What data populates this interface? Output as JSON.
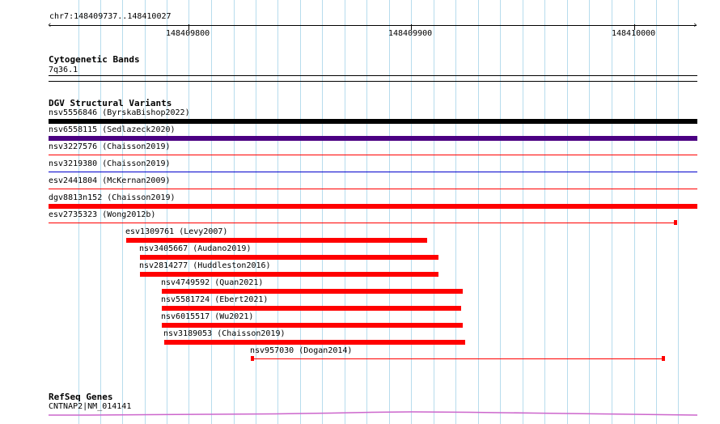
{
  "ruler": {
    "location": "chr7:148409737..148410027",
    "ticks": [
      "148409800",
      "148409900",
      "148410000"
    ]
  },
  "tracks": {
    "cytoband": {
      "title": "Cytogenetic Bands",
      "band_label": "7q36.1"
    },
    "dgv": {
      "title": "DGV Structural Variants",
      "features": [
        {
          "label": "nsv5556846 (ByrskaBishop2022)",
          "color": "#000000"
        },
        {
          "label": "nsv6558115 (Sedlazeck2020)",
          "color": "#4b0082"
        },
        {
          "label": "nsv3227576 (Chaisson2019)",
          "color": "#ff0000"
        },
        {
          "label": "nsv3219380 (Chaisson2019)",
          "color": "#0000cc"
        },
        {
          "label": "esv2441804 (McKernan2009)",
          "color": "#ff0000"
        },
        {
          "label": "dgv8813n152 (Chaisson2019)",
          "color": "#ff0000"
        },
        {
          "label": "esv2735323 (Wong2012b)",
          "color": "#ff0000"
        },
        {
          "label": "esv1309761 (Levy2007)",
          "color": "#ff0000"
        },
        {
          "label": "nsv3405667 (Audano2019)",
          "color": "#ff0000"
        },
        {
          "label": "nsv2814277 (Huddleston2016)",
          "color": "#ff0000"
        },
        {
          "label": "nsv4749592 (Quan2021)",
          "color": "#ff0000"
        },
        {
          "label": "nsv5581724 (Ebert2021)",
          "color": "#ff0000"
        },
        {
          "label": "nsv6015517 (Wu2021)",
          "color": "#ff0000"
        },
        {
          "label": "nsv3189053 (Chaisson2019)",
          "color": "#ff0000"
        },
        {
          "label": "nsv957030 (Dogan2014)",
          "color": "#ff0000"
        }
      ]
    },
    "refseq": {
      "title": "RefSeq Genes",
      "gene_label": "CNTNAP2|NM_014141",
      "color": "#cc66cc"
    }
  }
}
